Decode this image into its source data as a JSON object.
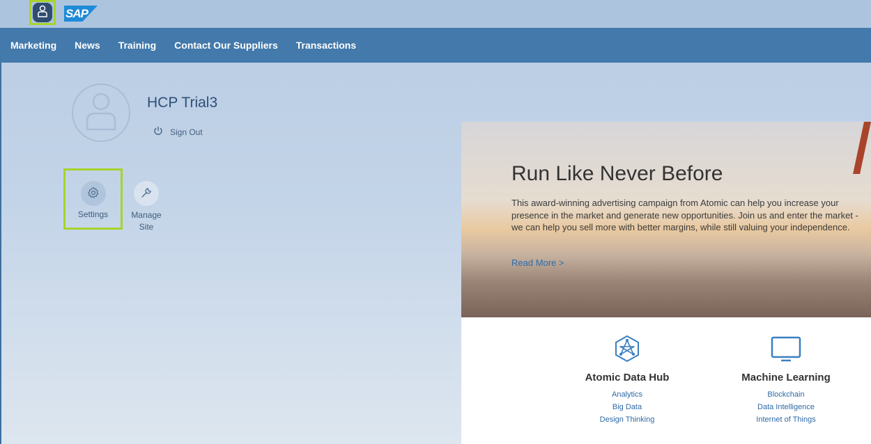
{
  "header": {
    "logo_text": "SAP"
  },
  "nav": {
    "items": [
      "Marketing",
      "News",
      "Training",
      "Contact Our Suppliers",
      "Transactions"
    ]
  },
  "profile": {
    "name": "HCP Trial3",
    "sign_out_label": "Sign Out"
  },
  "tiles": {
    "settings_label": "Settings",
    "manage_site_label": "Manage Site"
  },
  "hero": {
    "title": "Run Like Never Before",
    "body": "This award-winning advertising campaign from Atomic can help you increase your presence in the market and generate new opportunities. Join us and enter the market - we can help you sell more with better margins, while still valuing your independence.",
    "read_more": "Read More >"
  },
  "features": [
    {
      "title": "Atomic Data Hub",
      "links": [
        "Analytics",
        "Big Data",
        "Design Thinking"
      ]
    },
    {
      "title": "Machine Learning",
      "links": [
        "Blockchain",
        "Data Intelligence",
        "Internet of Things"
      ]
    }
  ],
  "colors": {
    "accent_highlight": "#a8d32a",
    "nav_bg": "#4379ab",
    "brand_blue": "#1f8ad6"
  }
}
